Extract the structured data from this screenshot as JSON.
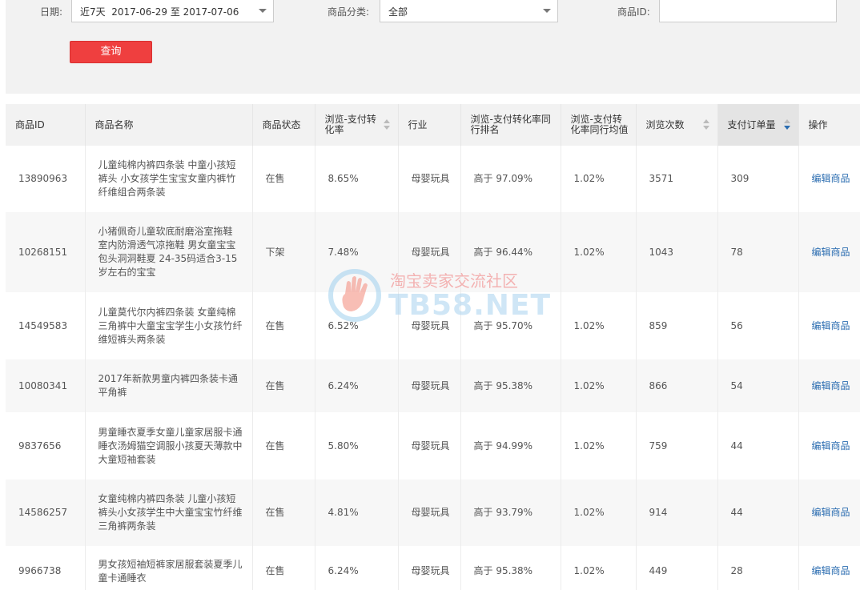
{
  "filters": {
    "date_label": "日期:",
    "date_value": "近7天  2017-06-29 至 2017-07-06",
    "category_label": "商品分类:",
    "category_value": "全部",
    "item_id_label": "商品ID:",
    "item_id_value": "",
    "query_button": "查询"
  },
  "table": {
    "headers": {
      "item_id": "商品ID",
      "item_name": "商品名称",
      "status": "商品状态",
      "conversion": "浏览-支付转化率",
      "industry": "行业",
      "rank": "浏览-支付转化率同行排名",
      "avg": "浏览-支付转化率同行均值",
      "views": "浏览次数",
      "orders": "支付订单量",
      "action": "操作"
    },
    "rows": [
      {
        "id": "13890963",
        "name": "儿童纯棉内裤四条装 中童小孩短裤头 小女孩学生宝宝女童内裤竹纤维组合两条装",
        "status": "在售",
        "conversion": "8.65%",
        "industry": "母婴玩具",
        "rank": "高于 97.09%",
        "avg": "1.02%",
        "views": "3571",
        "orders": "309",
        "action": "编辑商品"
      },
      {
        "id": "10268151",
        "name": "小猪佩奇儿童软底耐磨浴室拖鞋 室内防滑透气凉拖鞋 男女童宝宝包头洞洞鞋夏 24-35码适合3-15岁左右的宝宝",
        "status": "下架",
        "conversion": "7.48%",
        "industry": "母婴玩具",
        "rank": "高于 96.44%",
        "avg": "1.02%",
        "views": "1043",
        "orders": "78",
        "action": "编辑商品"
      },
      {
        "id": "14549583",
        "name": "儿童莫代尔内裤四条装 女童纯棉三角裤中大童宝宝学生小女孩竹纤维短裤头两条装",
        "status": "在售",
        "conversion": "6.52%",
        "industry": "母婴玩具",
        "rank": "高于 95.70%",
        "avg": "1.02%",
        "views": "859",
        "orders": "56",
        "action": "编辑商品"
      },
      {
        "id": "10080341",
        "name": "2017年新款男童内裤四条装卡通平角裤",
        "status": "在售",
        "conversion": "6.24%",
        "industry": "母婴玩具",
        "rank": "高于 95.38%",
        "avg": "1.02%",
        "views": "866",
        "orders": "54",
        "action": "编辑商品"
      },
      {
        "id": "9837656",
        "name": "男童睡衣夏季女童儿童家居服卡通睡衣汤姆猫空调服小孩夏天薄款中大童短袖套装",
        "status": "在售",
        "conversion": "5.80%",
        "industry": "母婴玩具",
        "rank": "高于 94.99%",
        "avg": "1.02%",
        "views": "759",
        "orders": "44",
        "action": "编辑商品"
      },
      {
        "id": "14586257",
        "name": "女童纯棉内裤四条装 儿童小孩短裤头小女孩学生中大童宝宝竹纤维三角裤两条装",
        "status": "在售",
        "conversion": "4.81%",
        "industry": "母婴玩具",
        "rank": "高于 93.79%",
        "avg": "1.02%",
        "views": "914",
        "orders": "44",
        "action": "编辑商品"
      },
      {
        "id": "9966738",
        "name": "男女孩短袖短裤家居服套装夏季儿童卡通睡衣",
        "status": "在售",
        "conversion": "6.24%",
        "industry": "母婴玩具",
        "rank": "高于 95.38%",
        "avg": "1.02%",
        "views": "449",
        "orders": "28",
        "action": "编辑商品"
      }
    ]
  },
  "watermark": {
    "cn": "淘宝卖家交流社区",
    "en": "TB58.NET"
  },
  "colors": {
    "query_button": "#ef3f3f",
    "link": "#2a6cb0",
    "panel_bg": "#f2f2f2"
  }
}
